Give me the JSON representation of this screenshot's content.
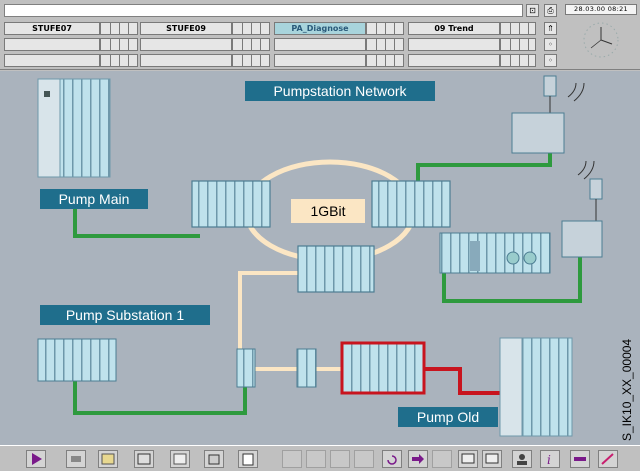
{
  "header": {
    "buttons": [
      {
        "label": "STUFE07"
      },
      {
        "label": "STUFE09"
      },
      {
        "label": "PA_Diagnose"
      },
      {
        "label": "09 Trend"
      }
    ],
    "datetime": "28.03.00  08:21"
  },
  "diagram": {
    "title": "Pumpstation Network",
    "ring_label": "1GBit",
    "labels": {
      "pump_main": "Pump Main",
      "pump_substation": "Pump Substation 1",
      "pump_old": "Pump Old"
    },
    "image_code": "S_IK10_XX_00004"
  },
  "colors": {
    "background": "#aab3bd",
    "label_bg": "#1f6e8c",
    "ring": "#fbe6c4",
    "link_green": "#2e9a3e",
    "link_red": "#c8141e",
    "highlight_red": "#c8141e"
  },
  "toolbar": {
    "icons": [
      "play-icon",
      "print-icon",
      "folder-icon",
      "window-icon",
      "calendar-icon",
      "archive-icon",
      "report-icon",
      "layout-icon",
      "nav-left-icon",
      "nav-up-icon",
      "nav-down-icon",
      "nav-right-icon",
      "undo-icon",
      "arrow-right-icon",
      "arrow-skip-icon",
      "screen-icon",
      "screen2-icon",
      "user-icon",
      "info-icon",
      "key-icon",
      "edit-icon"
    ]
  }
}
